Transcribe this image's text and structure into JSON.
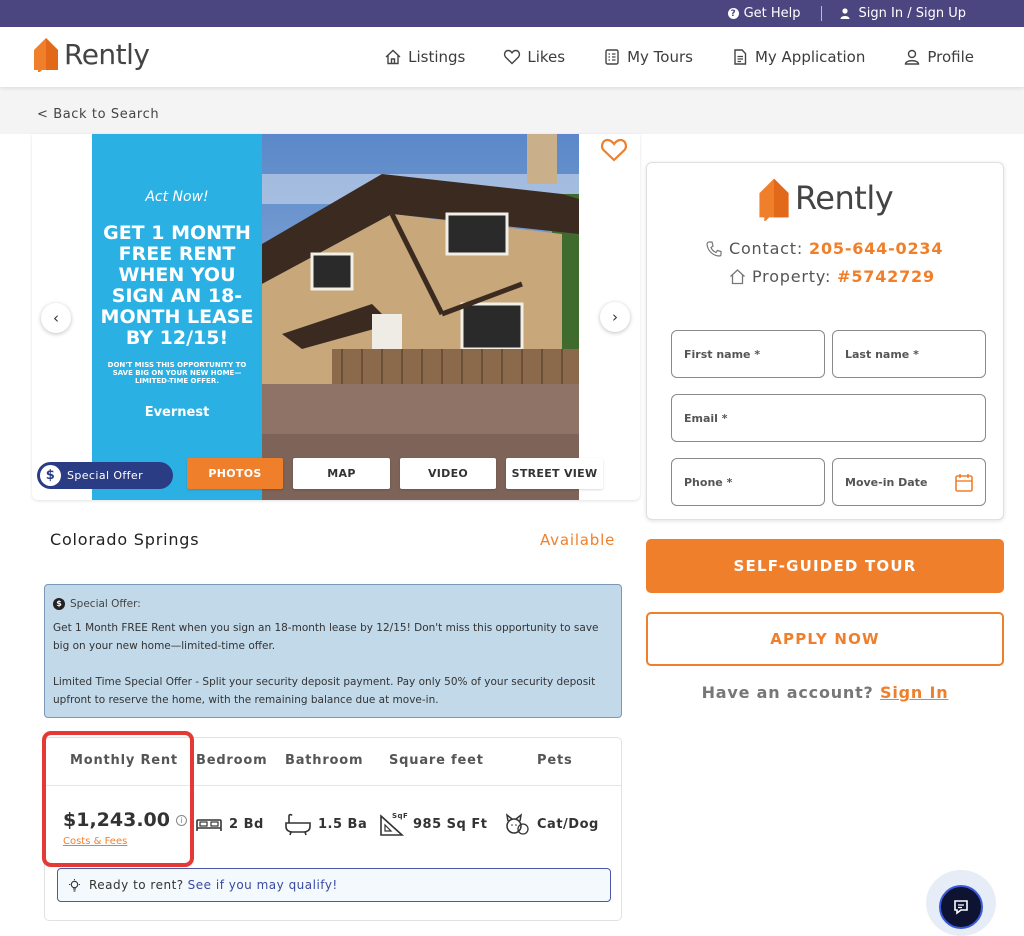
{
  "topbar": {
    "help_label": "Get Help",
    "signin_label": "Sign In / Sign Up"
  },
  "brand": {
    "name": "Rently",
    "accent": "#f07f2b",
    "topbar_color": "#4b4580",
    "badge_color": "#2a3c84"
  },
  "nav": {
    "listings": "Listings",
    "likes": "Likes",
    "tours": "My Tours",
    "application": "My Application",
    "profile": "Profile"
  },
  "back_label": "< Back to Search",
  "gallery": {
    "promo": {
      "act_now": "Act Now!",
      "headline": "GET 1 MONTH FREE RENT WHEN YOU SIGN AN 18-MONTH LEASE BY 12/15!",
      "fine_print": "DON'T MISS THIS OPPORTUNITY TO SAVE BIG ON YOUR NEW HOME—LIMITED-TIME OFFER.",
      "brand": "Evernest"
    },
    "special_badge": "Special Offer",
    "tabs": [
      "PHOTOS",
      "MAP",
      "VIDEO",
      "STREET VIEW"
    ],
    "active_tab": "PHOTOS"
  },
  "listing": {
    "city": "Colorado Springs",
    "status": "Available",
    "offer": {
      "heading": "Special Offer:",
      "p1": "Get 1 Month FREE Rent when you sign an 18-month lease by 12/15! Don't miss this opportunity to save big on your new home—limited-time offer.",
      "p2": "Limited Time Special Offer - Split your security deposit payment. Pay only 50% of your security deposit upfront to reserve the home, with the remaining balance due at move-in."
    },
    "stats": {
      "headers": {
        "rent": "Monthly Rent",
        "bed": "Bedroom",
        "bath": "Bathroom",
        "sqft": "Square feet",
        "pets": "Pets"
      },
      "rent": "$1,243.00",
      "costs_link": "Costs & Fees",
      "bed": "2 Bd",
      "bath": "1.5 Ba",
      "sqft": "985 Sq Ft",
      "sqft_icon_label": "SqFt",
      "pets": "Cat/Dog"
    },
    "ready": {
      "text": "Ready to rent?",
      "link": "See if you may qualify!"
    }
  },
  "contact": {
    "contact_label": "Contact:",
    "phone": "205-644-0234",
    "property_label": "Property:",
    "property_id": "#5742729",
    "fields": {
      "first": "First name *",
      "last": "Last name *",
      "email": "Email *",
      "phone": "Phone *",
      "move_in": "Move-in Date"
    },
    "tour_button": "SELF-GUIDED TOUR",
    "apply_button": "APPLY NOW",
    "have_account": "Have an account?",
    "sign_in": "Sign In"
  }
}
